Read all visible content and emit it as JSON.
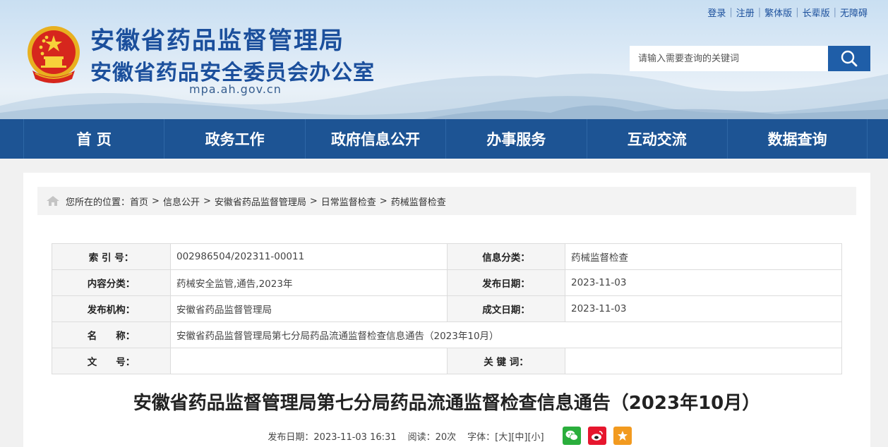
{
  "header": {
    "title_main": "安徽省药品监督管理局",
    "title_sub": "安徽省药品安全委员会办公室",
    "domain": "mpa.ah.gov.cn",
    "top_links": [
      "登录",
      "注册",
      "繁体版",
      "长辈版",
      "无障碍"
    ],
    "search_placeholder": "请输入需要查询的关键词"
  },
  "nav": {
    "items": [
      "首 页",
      "政务工作",
      "政府信息公开",
      "办事服务",
      "互动交流",
      "数据查询"
    ]
  },
  "breadcrumb": {
    "prefix": "您所在的位置：",
    "items": [
      "首页",
      "信息公开",
      "安徽省药品监督管理局",
      "日常监督检查",
      "药械监督检查"
    ],
    "separator": ">"
  },
  "meta": {
    "index_label": "索 引 号：",
    "index_value": "002986504/202311-00011",
    "info_cat_label": "信息分类：",
    "info_cat_value": "药械监督检查",
    "content_cat_label": "内容分类：",
    "content_cat_value": "药械安全监管,通告,2023年",
    "pub_date_label": "发布日期：",
    "pub_date_value": "2023-11-03",
    "org_label": "发布机构：",
    "org_value": "安徽省药品监督管理局",
    "doc_date_label": "成文日期：",
    "doc_date_value": "2023-11-03",
    "name_label": "名　　称：",
    "name_value": "安徽省药品监督管理局第七分局药品流通监督检查信息通告（2023年10月）",
    "docno_label": "文　　号：",
    "docno_value": "",
    "keywords_label": "关 键 词：",
    "keywords_value": ""
  },
  "article": {
    "title": "安徽省药品监督管理局第七分局药品流通监督检查信息通告（2023年10月）",
    "publish_time": "发布日期：2023-11-03 16:31",
    "reads": "阅读：20次",
    "font_size_label": "字体：",
    "font_large": "[大]",
    "font_medium": "[中]",
    "font_small": "[小]"
  },
  "share": {
    "icons": [
      "wechat-icon",
      "weibo-icon",
      "favorite-icon"
    ],
    "colors": {
      "wechat": "#2aae3c",
      "weibo": "#e6162d",
      "favorite": "#f29a1f"
    }
  },
  "colors": {
    "brand_blue": "#1b4f9c",
    "nav_blue": "#1d5494",
    "search_button": "#1f5ea8"
  }
}
